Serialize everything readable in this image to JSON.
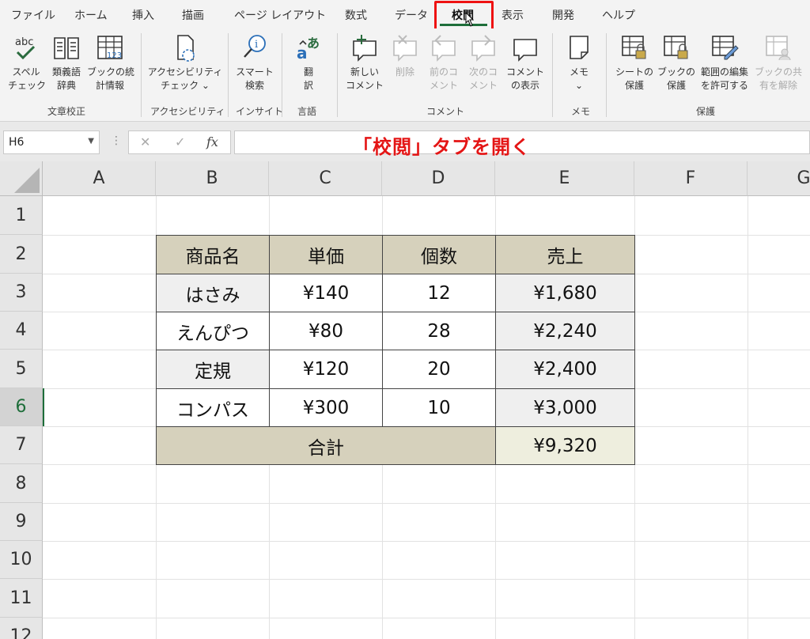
{
  "tabs": [
    "ファイル",
    "ホーム",
    "挿入",
    "描画",
    "ページ レイアウト",
    "数式",
    "データ",
    "校閲",
    "表示",
    "開発",
    "ヘルプ"
  ],
  "ribbon": {
    "spell": [
      "スペル",
      "チェック"
    ],
    "thesaurus": [
      "類義語",
      "辞典"
    ],
    "stats": [
      "ブックの統",
      "計情報"
    ],
    "grp_proof": "文章校正",
    "access": [
      "アクセシビリティ",
      "チェック ⌄"
    ],
    "grp_access": "アクセシビリティ",
    "smart": [
      "スマート",
      "検索"
    ],
    "grp_insight": "インサイト",
    "translate": [
      "翻",
      "訳"
    ],
    "grp_lang": "言語",
    "newc": [
      "新しい",
      "コメント"
    ],
    "del": [
      "削除"
    ],
    "prev": [
      "前のコ",
      "メント"
    ],
    "next": [
      "次のコ",
      "メント"
    ],
    "show": [
      "コメント",
      "の表示"
    ],
    "grp_comment": "コメント",
    "memo": [
      "メモ",
      "⌄"
    ],
    "grp_memo": "メモ",
    "psheet": [
      "シートの",
      "保護"
    ],
    "pbook": [
      "ブックの",
      "保護"
    ],
    "range": [
      "範囲の編集",
      "を許可する"
    ],
    "unshare": [
      "ブックの共",
      "有を解除"
    ],
    "grp_protect": "保護"
  },
  "formula_bar": {
    "namebox": "H6",
    "cancel": "✕",
    "enter": "✓",
    "fx": "fx"
  },
  "annotation": "「校閲」タブを開く",
  "columns": [
    "A",
    "B",
    "C",
    "D",
    "E",
    "F",
    "G"
  ],
  "rows": [
    "1",
    "2",
    "3",
    "4",
    "5",
    "6",
    "7",
    "8",
    "9",
    "10",
    "11",
    "12"
  ],
  "table": {
    "headers": [
      "商品名",
      "単価",
      "個数",
      "売上"
    ],
    "rows": [
      [
        "はさみ",
        "¥140",
        "12",
        "¥1,680"
      ],
      [
        "えんぴつ",
        "¥80",
        "28",
        "¥2,240"
      ],
      [
        "定規",
        "¥120",
        "20",
        "¥2,400"
      ],
      [
        "コンパス",
        "¥300",
        "10",
        "¥3,000"
      ]
    ],
    "total_label": "合計",
    "total_value": "¥9,320"
  },
  "colors": {
    "accent": "#1e6e3a",
    "highlight": "#e41515",
    "table_header": "#d6d1bc"
  }
}
